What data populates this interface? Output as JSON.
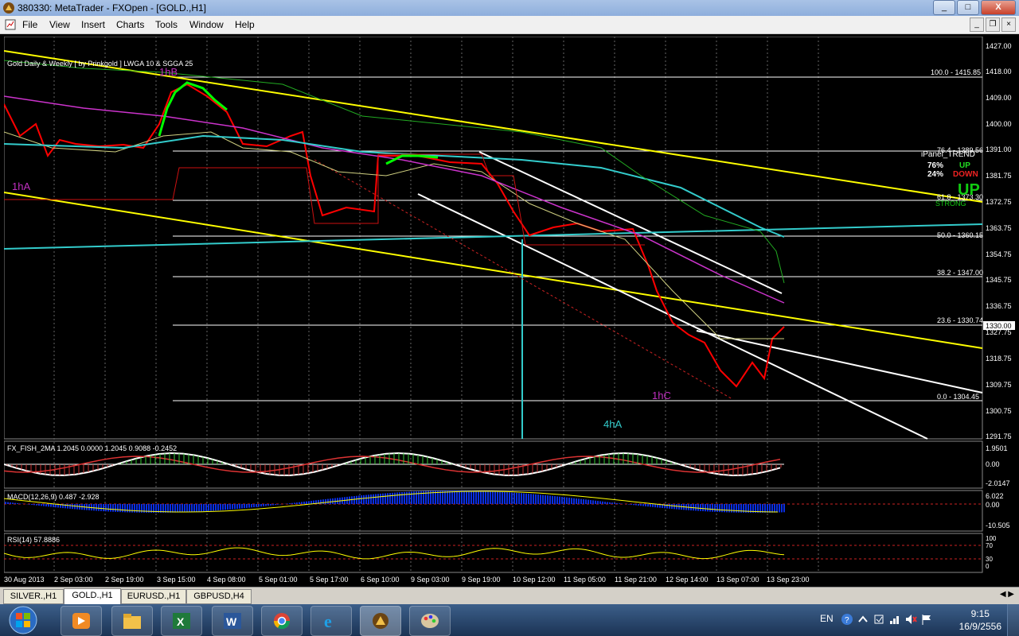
{
  "window": {
    "title": "380330: MetaTrader - FXOpen - [GOLD.,H1]",
    "min": "_",
    "max": "□",
    "close": "X"
  },
  "menu": {
    "items": [
      "File",
      "View",
      "Insert",
      "Charts",
      "Tools",
      "Window",
      "Help"
    ]
  },
  "chart": {
    "header": "Gold Daily & Weekly [ by Prinkgold ] LWGA 10 & SGGA 25",
    "price_axis": [
      "1427.00",
      "1418.00",
      "1409.00",
      "1400.00",
      "1391.00",
      "1381.75",
      "1372.75",
      "1363.75",
      "1354.75",
      "1345.75",
      "1336.75",
      "1327.75",
      "1318.75",
      "1309.75",
      "1300.75",
      "1291.75"
    ],
    "current_price": "1330.00",
    "fib_levels": [
      "100.0 - 1415.85",
      "76.4 - 1389.56",
      "61.8 - 1373.30",
      "50.0 - 1360.15",
      "38.2 - 1347.00",
      "23.6 - 1330.74",
      "0.0 - 1304.45"
    ],
    "wave_labels": [
      "1hA",
      "1hB",
      "1hC",
      "4hA"
    ],
    "ipanel": {
      "title": "iPanel_TREND",
      "up_pct": "76%",
      "up_label": "UP",
      "down_pct": "24%",
      "down_label": "DOWN",
      "state": "UP",
      "strength": "STRONG"
    },
    "fish": {
      "label": "FX_FISH_2MA 1.2045 0.0000 1.2045 0.9088 -0.2452",
      "axis": [
        "1.9501",
        "0.00",
        "-2.0147"
      ]
    },
    "macd": {
      "label": "MACD(12,26,9) 0.487 -2.928",
      "axis": [
        "6.022",
        "0.00",
        "-10.505"
      ]
    },
    "rsi": {
      "label": "RSI(14) 57.8886",
      "axis": [
        "100",
        "70",
        "30",
        "0"
      ]
    },
    "time_axis": [
      "30 Aug 2013",
      "2 Sep 03:00",
      "2 Sep 19:00",
      "3 Sep 15:00",
      "4 Sep 08:00",
      "5 Sep 01:00",
      "5 Sep 17:00",
      "6 Sep 10:00",
      "9 Sep 03:00",
      "9 Sep 19:00",
      "10 Sep 12:00",
      "11 Sep 05:00",
      "11 Sep 21:00",
      "12 Sep 14:00",
      "13 Sep 07:00",
      "13 Sep 23:00"
    ]
  },
  "tabs": [
    "SILVER.,H1",
    "GOLD.,H1",
    "EURUSD.,H1",
    "GBPUSD,H4"
  ],
  "tabs_active": "GOLD.,H1",
  "tray": {
    "lang": "EN",
    "time": "9:15",
    "date": "16/9/2556"
  },
  "colors": {
    "bull": "#00ff00",
    "bear": "#ff0000",
    "fib": "#ffffff",
    "channel": "#ffff00",
    "ma_cyan": "#33cccc",
    "ma_magenta": "#cc33cc",
    "ma_green": "#22aa22",
    "label_magenta": "#c030c0"
  }
}
